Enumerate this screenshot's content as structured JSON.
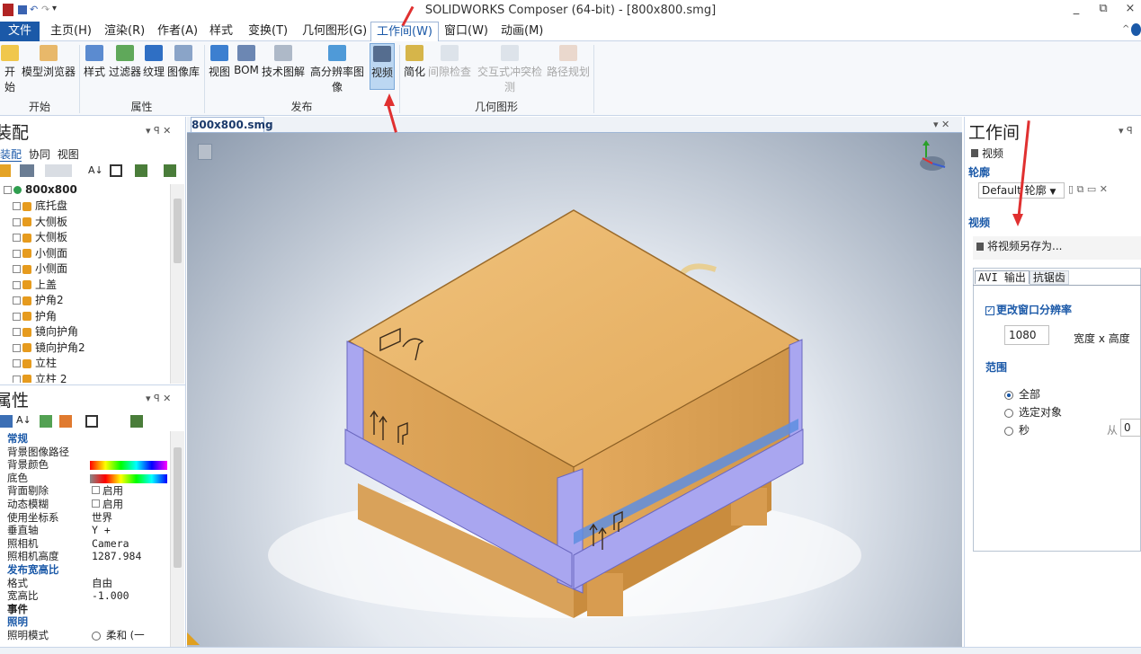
{
  "window": {
    "title": "SOLIDWORKS Composer (64-bit) - [800x800.smg]",
    "controls": [
      "_",
      "⧉",
      "×"
    ]
  },
  "menu": {
    "file": "文件",
    "items": [
      "主页(H)",
      "渲染(R)",
      "作者(A)",
      "样式",
      "变换(T)",
      "几何图形(G)",
      "工作间(W)",
      "窗口(W)",
      "动画(M)"
    ],
    "active": "工作间(W)"
  },
  "ribbon": {
    "groups": [
      {
        "label": "开始",
        "buttons": [
          "开始",
          "模型浏览器"
        ]
      },
      {
        "label": "属性",
        "buttons": [
          "样式",
          "过滤器",
          "纹理",
          "图像库"
        ]
      },
      {
        "label": "发布",
        "buttons": [
          "视图",
          "BOM",
          "技术图解",
          "高分辨率图像",
          "视频"
        ]
      },
      {
        "label": "几何图形",
        "buttons": [
          "简化",
          "间隙检查",
          "交互式冲突检测",
          "路径规划"
        ]
      }
    ],
    "selected_button": "视频"
  },
  "assembly_panel": {
    "title": "装配",
    "tabs": [
      "装配",
      "协同",
      "视图"
    ],
    "root": "800x800",
    "items": [
      "底托盘",
      "大侧板",
      "大侧板",
      "小侧面",
      "小侧面",
      "上盖",
      "护角2",
      "护角",
      "镜向护角",
      "镜向护角2",
      "立柱",
      "立柱 2"
    ]
  },
  "properties_panel": {
    "title": "属性",
    "rows": [
      {
        "cat": "常规"
      },
      {
        "key": "背景图像路径",
        "val": ""
      },
      {
        "key": "背景颜色",
        "val": ""
      },
      {
        "key": "底色",
        "val": ""
      },
      {
        "key": "背面剔除",
        "val": "启用"
      },
      {
        "key": "动态模糊",
        "val": "启用"
      },
      {
        "key": "使用坐标系",
        "val": "世界"
      },
      {
        "key": "垂直轴",
        "val": "Y +"
      },
      {
        "key": "照相机",
        "val": "Camera"
      },
      {
        "key": "照相机高度",
        "val": "1287.984"
      },
      {
        "cat": "发布宽高比"
      },
      {
        "key": "格式",
        "val": "自由"
      },
      {
        "key": "宽高比",
        "val": "-1.000"
      },
      {
        "cat": "事件"
      },
      {
        "cat": "照明"
      },
      {
        "key": "照明模式",
        "val": "柔和 (一"
      }
    ]
  },
  "document": {
    "tab": "800x800.smg"
  },
  "workspace": {
    "title": "工作间",
    "sub": "视频",
    "outline_label": "轮廓",
    "profile": "Default 轮廓",
    "video_label": "视频",
    "save_as": "将视频另存为...",
    "tabs": [
      "AVI 输出",
      "抗锯齿"
    ],
    "change_res": "更改窗口分辨率",
    "width_value": "1080",
    "wh_label": "宽度 x 高度",
    "range_label": "范围",
    "range_opts": [
      "全部",
      "选定对象",
      "秒"
    ],
    "from_label": "从",
    "from_value": "0"
  },
  "colors": {
    "accent": "#1b59a8",
    "wood": "#e7b66c",
    "corner": "#a9a6f0",
    "arrow": "#e03030"
  }
}
